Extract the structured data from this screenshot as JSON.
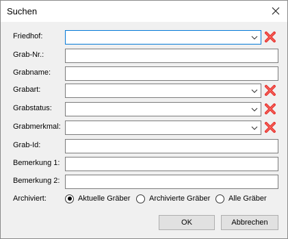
{
  "window": {
    "title": "Suchen"
  },
  "fields": {
    "friedhof": {
      "label": "Friedhof:",
      "value": ""
    },
    "grab_nr": {
      "label": "Grab-Nr.:",
      "value": ""
    },
    "grabname": {
      "label": "Grabname:",
      "value": ""
    },
    "grabart": {
      "label": "Grabart:",
      "value": ""
    },
    "grabstatus": {
      "label": "Grabstatus:",
      "value": ""
    },
    "grabmerkmal": {
      "label": "Grabmerkmal:",
      "value": ""
    },
    "grab_id": {
      "label": "Grab-Id:",
      "value": ""
    },
    "bemerkung1": {
      "label": "Bemerkung 1:",
      "value": ""
    },
    "bemerkung2": {
      "label": "Bemerkung 2:",
      "value": ""
    }
  },
  "archiviert": {
    "label": "Archiviert:",
    "options": [
      "Aktuelle Gräber",
      "Archivierte Gräber",
      "Alle Gräber"
    ],
    "selected": "Aktuelle Gräber"
  },
  "buttons": {
    "ok": "OK",
    "cancel": "Abbrechen"
  },
  "icons": {
    "close": "close-icon",
    "dropdown": "chevron-down-icon",
    "clear": "clear-x-icon"
  },
  "colors": {
    "clear_icon": "#e8312f",
    "focus_border": "#0078d7"
  }
}
